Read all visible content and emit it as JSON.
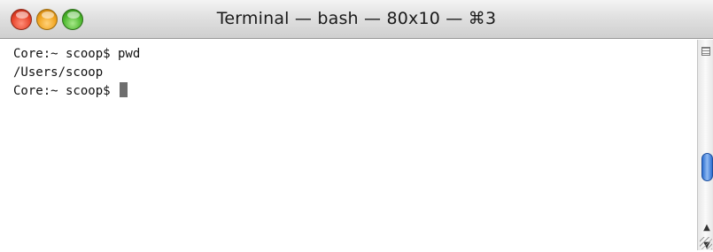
{
  "window": {
    "title": "Terminal — bash — 80x10 — ⌘3"
  },
  "terminal": {
    "lines": [
      "Core:~ scoop$ pwd",
      "/Users/scoop",
      "Core:~ scoop$ "
    ]
  },
  "icons": {
    "close": "close-icon",
    "minimize": "minimize-icon",
    "zoom": "zoom-icon",
    "split": "split-pane-icon",
    "scroll_up": "chevron-up-icon",
    "scroll_down": "chevron-down-icon",
    "resize": "resize-grip-icon"
  },
  "colors": {
    "close": "#e8452c",
    "minimize": "#f0a21c",
    "zoom": "#4cb82d",
    "scroll_thumb": "#2e6fd1",
    "cursor": "#6e6e6e"
  }
}
